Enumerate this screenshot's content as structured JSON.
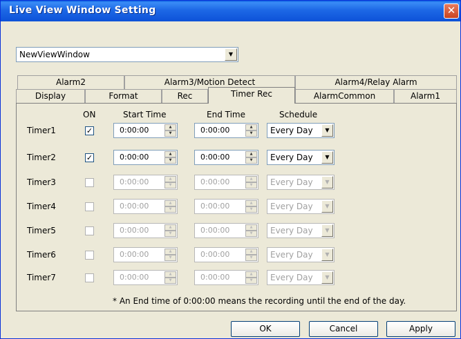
{
  "window": {
    "title": "Live View Window Setting",
    "close_glyph": "✕"
  },
  "view_window_select": {
    "value": "NewViewWindow",
    "arrow": "▼"
  },
  "tabs_back": [
    "Alarm2",
    "Alarm3/Motion Detect",
    "Alarm4/Relay Alarm"
  ],
  "tabs_front": [
    "Display",
    "Format",
    "Rec",
    "Timer Rec",
    "AlarmCommon",
    "Alarm1"
  ],
  "active_tab": "Timer Rec",
  "headers": {
    "on": "ON",
    "start": "Start Time",
    "end": "End Time",
    "schedule": "Schedule"
  },
  "timers": [
    {
      "label": "Timer1",
      "on": true,
      "start": "0:00:00",
      "end": "0:00:00",
      "schedule": "Every Day",
      "enabled": true
    },
    {
      "label": "Timer2",
      "on": true,
      "start": "0:00:00",
      "end": "0:00:00",
      "schedule": "Every Day",
      "enabled": true
    },
    {
      "label": "Timer3",
      "on": false,
      "start": "0:00:00",
      "end": "0:00:00",
      "schedule": "Every Day",
      "enabled": false
    },
    {
      "label": "Timer4",
      "on": false,
      "start": "0:00:00",
      "end": "0:00:00",
      "schedule": "Every Day",
      "enabled": false
    },
    {
      "label": "Timer5",
      "on": false,
      "start": "0:00:00",
      "end": "0:00:00",
      "schedule": "Every Day",
      "enabled": false
    },
    {
      "label": "Timer6",
      "on": false,
      "start": "0:00:00",
      "end": "0:00:00",
      "schedule": "Every Day",
      "enabled": false
    },
    {
      "label": "Timer7",
      "on": false,
      "start": "0:00:00",
      "end": "0:00:00",
      "schedule": "Every Day",
      "enabled": false
    }
  ],
  "check_glyph": "✓",
  "note": "* An End time of 0:00:00 means the recording until the end of the day.",
  "buttons": {
    "ok": "OK",
    "cancel": "Cancel",
    "apply": "Apply"
  },
  "colors": {
    "titlebar": "#0a5ee0",
    "dialog_bg": "#ece9d8",
    "disabled_text": "#a0a0a0"
  }
}
